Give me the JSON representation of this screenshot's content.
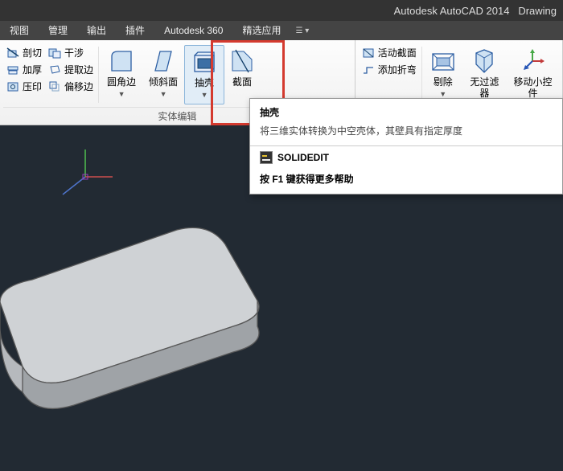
{
  "title": {
    "app": "Autodesk AutoCAD 2014",
    "doc": "Drawing"
  },
  "menu": {
    "items": [
      "视图",
      "管理",
      "输出",
      "插件",
      "Autodesk 360",
      "精选应用"
    ]
  },
  "ribbon": {
    "panel1": {
      "title": "实体编辑",
      "small": {
        "c0": [
          "剖切",
          "加厚",
          "压印"
        ],
        "c1": [
          "干涉",
          "提取边",
          "偏移边"
        ]
      },
      "big": [
        "圆角边",
        "倾斜面",
        "抽壳",
        "截面"
      ]
    },
    "panel2": {
      "small": [
        "活动截面",
        "添加折弯"
      ],
      "big": [
        "剔除",
        "无过滤器",
        "移动小控件"
      ]
    }
  },
  "tooltip": {
    "title": "抽壳",
    "desc": "将三维实体转换为中空壳体，其壁具有指定厚度",
    "command": "SOLIDEDIT",
    "help": "按 F1 键获得更多帮助"
  }
}
